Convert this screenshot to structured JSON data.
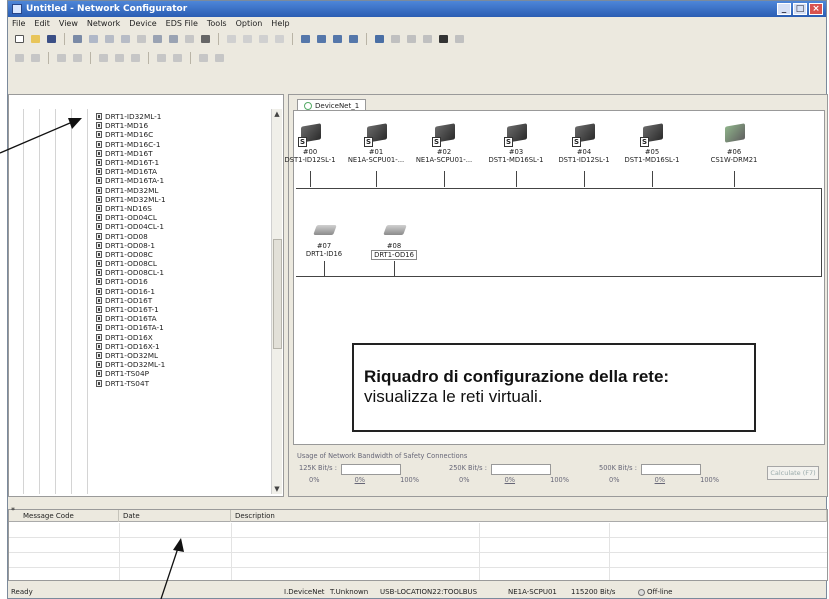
{
  "window": {
    "title": "Untitled - Network Configurator",
    "controls": [
      "_",
      "□",
      "×"
    ]
  },
  "menu": [
    "File",
    "Edit",
    "View",
    "Network",
    "Device",
    "EDS File",
    "Tools",
    "Option",
    "Help"
  ],
  "tree": {
    "items": [
      "DRT1-ID32ML-1",
      "DRT1-MD16",
      "DRT1-MD16C",
      "DRT1-MD16C-1",
      "DRT1-MD16T",
      "DRT1-MD16T-1",
      "DRT1-MD16TA",
      "DRT1-MD16TA-1",
      "DRT1-MD32ML",
      "DRT1-MD32ML-1",
      "DRT1-ND16S",
      "DRT1-OD04CL",
      "DRT1-OD04CL-1",
      "DRT1-OD08",
      "DRT1-OD08-1",
      "DRT1-OD08C",
      "DRT1-OD08CL",
      "DRT1-OD08CL-1",
      "DRT1-OD16",
      "DRT1-OD16-1",
      "DRT1-OD16T",
      "DRT1-OD16T-1",
      "DRT1-OD16TA",
      "DRT1-OD16TA-1",
      "DRT1-OD16X",
      "DRT1-OD16X-1",
      "DRT1-OD32ML",
      "DRT1-OD32ML-1",
      "DRT1-TS04P",
      "DRT1-TS04T"
    ]
  },
  "network": {
    "tab_label": "DeviceNet_1",
    "row1": [
      {
        "addr": "#00",
        "model": "DST1-ID12SL-1",
        "style": "black"
      },
      {
        "addr": "#01",
        "model": "NE1A-SCPU01-...",
        "style": "black"
      },
      {
        "addr": "#02",
        "model": "NE1A-SCPU01-...",
        "style": "black"
      },
      {
        "addr": "#03",
        "model": "DST1-MD16SL-1",
        "style": "black"
      },
      {
        "addr": "#04",
        "model": "DST1-ID12SL-1",
        "style": "black"
      },
      {
        "addr": "#05",
        "model": "DST1-MD16SL-1",
        "style": "black"
      },
      {
        "addr": "#06",
        "model": "CS1W-DRM21",
        "style": "green"
      }
    ],
    "row2": [
      {
        "addr": "#07",
        "model": "DRT1-ID16"
      },
      {
        "addr": "#08",
        "model": "DRT1-OD16"
      }
    ],
    "callout": {
      "heading": "Riquadro di configurazione della rete:",
      "text": "visualizza le reti virtuali."
    }
  },
  "bandwidth": {
    "title": "Usage of Network Bandwidth of Safety Connections",
    "groups": [
      {
        "label": "125K Bit/s :",
        "min": "0%",
        "mid": "0%",
        "max": "100%"
      },
      {
        "label": "250K Bit/s :",
        "min": "0%",
        "mid": "0%",
        "max": "100%"
      },
      {
        "label": "500K Bit/s :",
        "min": "0%",
        "mid": "0%",
        "max": "100%"
      }
    ],
    "calc_button": "Calculate (F7)"
  },
  "messages": {
    "columns": [
      "Message Code",
      "Date",
      "Description"
    ]
  },
  "status": {
    "ready": "Ready",
    "network": "I.DeviceNet",
    "unknown": "T.Unknown",
    "usb": "USB-LOCATION22:TOOLBUS",
    "device": "NE1A-SCPU01",
    "baud": "115200 Bit/s",
    "mode": "Off-line"
  }
}
